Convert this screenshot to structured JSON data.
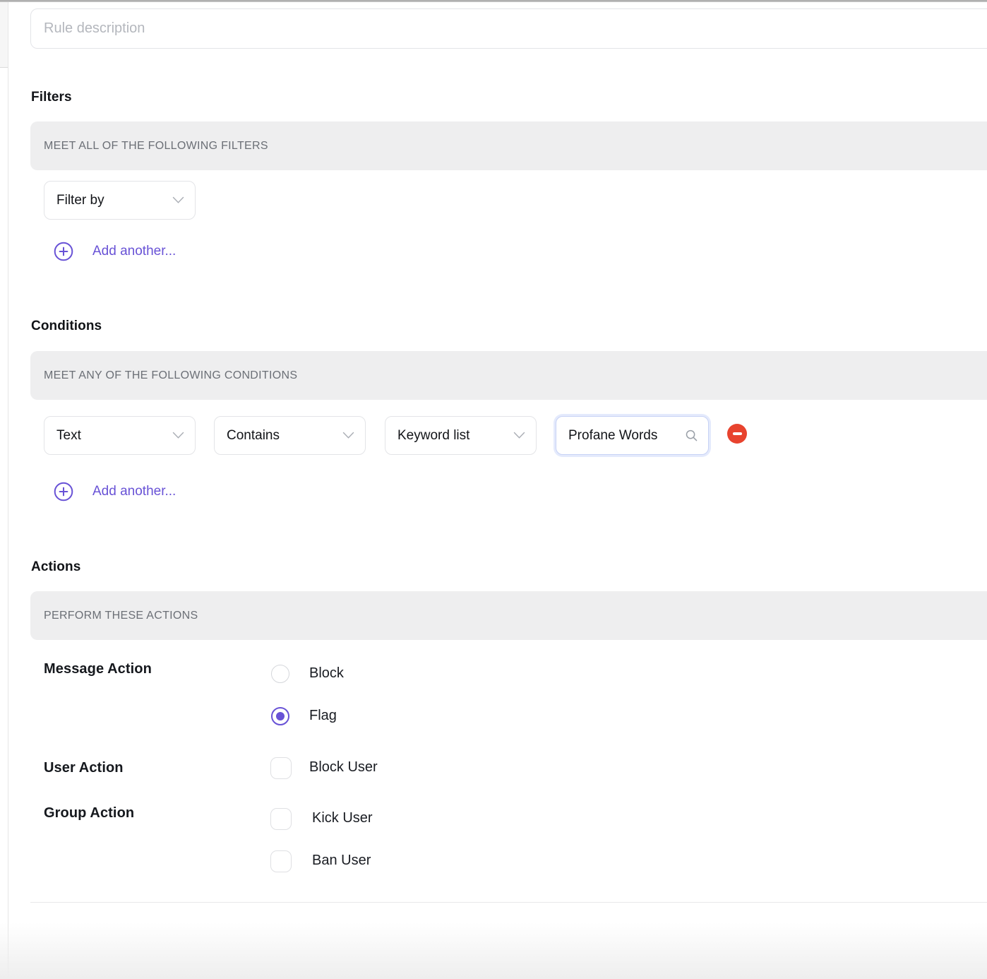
{
  "theme": {
    "accent_color": "#6852d6",
    "danger_color": "#e8432e",
    "banner_bg": "#eeeeef",
    "banner_text_color": "#6b6f76"
  },
  "rule_form": {
    "description_placeholder": "Rule description"
  },
  "filters": {
    "heading": "Filters",
    "banner": "MEET ALL OF THE FOLLOWING FILTERS",
    "filter_by": {
      "value": "Filter by"
    },
    "add_another_label": "Add another..."
  },
  "conditions": {
    "heading": "Conditions",
    "banner": "MEET ANY OF THE FOLLOWING CONDITIONS",
    "subject": {
      "value": "Text"
    },
    "operator": {
      "value": "Contains"
    },
    "value_type": {
      "value": "Keyword list"
    },
    "keyword_list": {
      "value": "Profane Words"
    },
    "add_another_label": "Add another..."
  },
  "actions": {
    "heading": "Actions",
    "banner": "PERFORM THESE ACTIONS",
    "message_action": {
      "label": "Message Action",
      "options": [
        {
          "label": "Block",
          "selected": false
        },
        {
          "label": "Flag",
          "selected": true
        }
      ]
    },
    "user_action": {
      "label": "User Action",
      "options": [
        {
          "label": "Block User",
          "checked": false
        }
      ]
    },
    "group_action": {
      "label": "Group Action",
      "options": [
        {
          "label": "Kick User",
          "checked": false
        },
        {
          "label": "Ban User",
          "checked": false
        }
      ]
    }
  }
}
